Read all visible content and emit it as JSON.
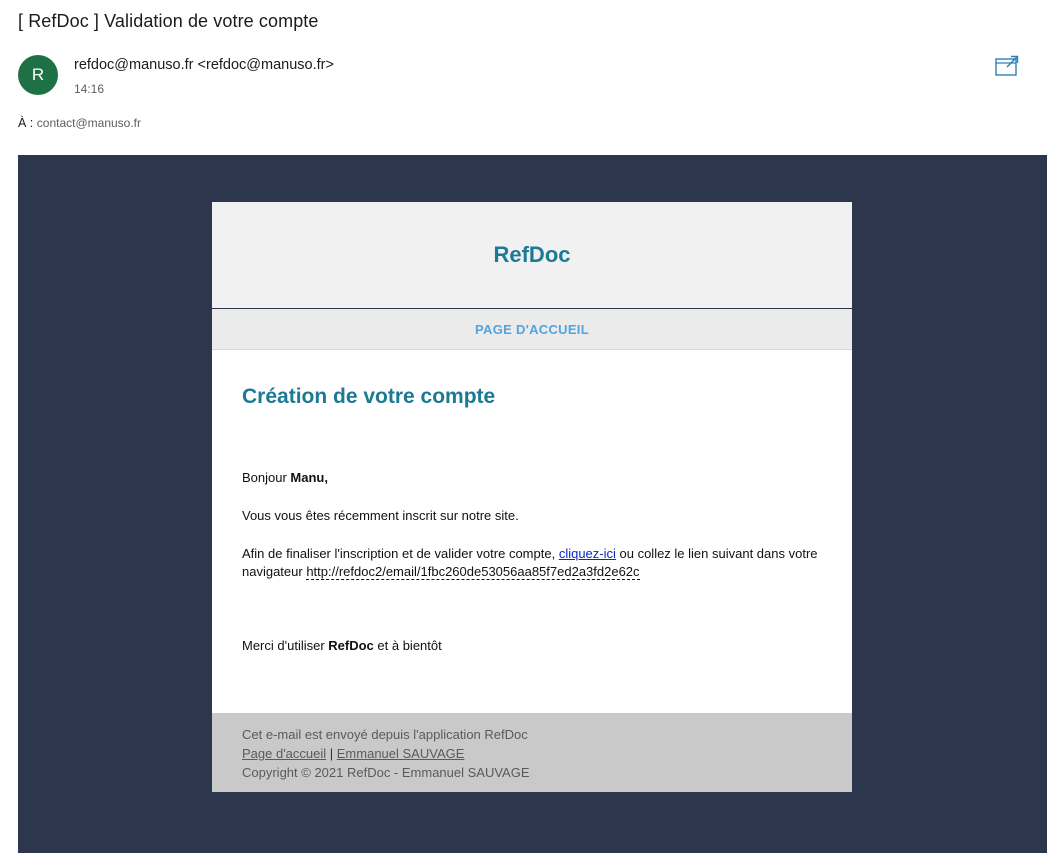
{
  "subject": "[ RefDoc ] Validation de votre compte",
  "sender": {
    "avatar_initial": "R",
    "display": "refdoc@manuso.fr <refdoc@manuso.fr>",
    "time": "14:16"
  },
  "recipient": {
    "label": "À :",
    "address": "contact@manuso.fr"
  },
  "email": {
    "brand": "RefDoc",
    "nav_link": "PAGE D'ACCUEIL",
    "title": "Création de votre compte",
    "greeting_prefix": "Bonjour ",
    "greeting_name": "Manu,",
    "paragraph1": "Vous vous êtes récemment inscrit sur notre site.",
    "paragraph2_prefix": "Afin de finaliser l'inscription et de valider votre compte, ",
    "paragraph2_link": "cliquez-ici",
    "paragraph2_middle": " ou collez le lien suivant dans votre navigateur ",
    "validation_url": "http://refdoc2/email/1fbc260de53056aa85f7ed2a3fd2e62c",
    "thanks_prefix": "Merci d'utiliser ",
    "thanks_brand": "RefDoc",
    "thanks_suffix": " et à bientôt",
    "footer": {
      "line1": "Cet e-mail est envoyé depuis l'application RefDoc",
      "link_home": "Page d'accueil",
      "separator": " | ",
      "link_author": "Emmanuel SAUVAGE",
      "copyright": "Copyright © 2021 RefDoc - Emmanuel SAUVAGE"
    }
  },
  "icons": {
    "popout": "open-in-new-window-icon"
  },
  "colors": {
    "frame_background": "#2c374e",
    "brand": "#1d7a95",
    "nav_link": "#52a4df",
    "avatar": "#1e7145",
    "link": "#0b28c9"
  }
}
